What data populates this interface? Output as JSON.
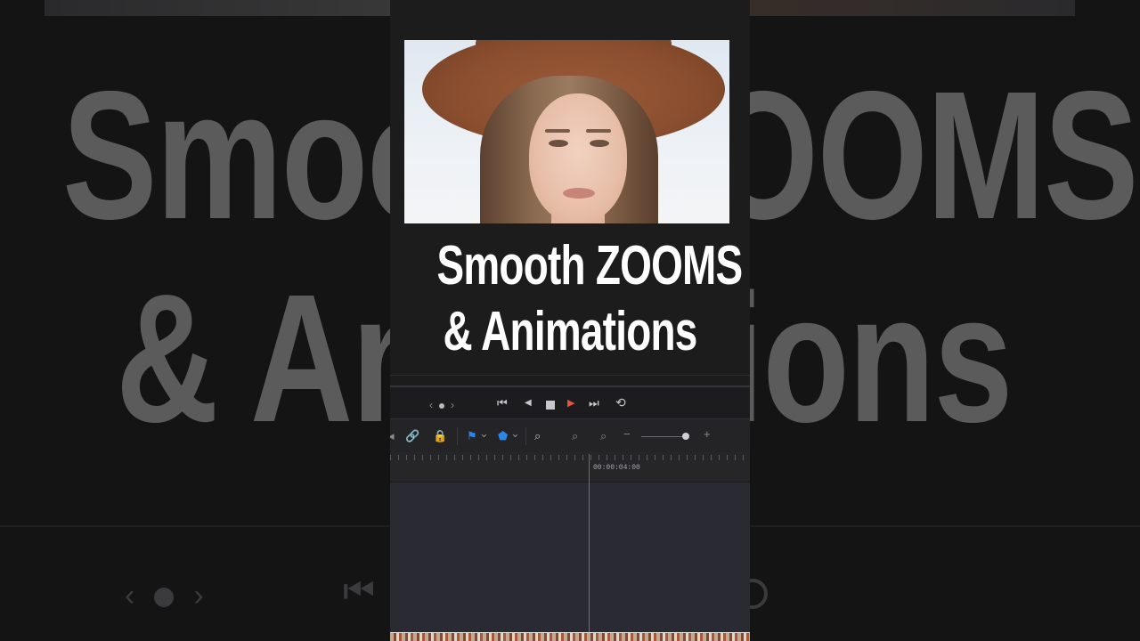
{
  "background": {
    "line1": "Smooth ZOOMS",
    "line2": "& Animations"
  },
  "title": {
    "line1": "Smooth ZOOMS",
    "line2": "& Animations"
  },
  "transport": {
    "prev_glyph": "‹",
    "next_glyph": "›",
    "skip_back_glyph": "⏮",
    "step_back_glyph": "◀",
    "play_glyph": "▶",
    "skip_forward_glyph": "⏭",
    "loop_glyph": "⟲"
  },
  "toolbar": {
    "link_glyph": "🔗",
    "lock_glyph": "🔒",
    "chevron_glyph": "⌄",
    "zoom_out_glyph": "−",
    "zoom_in_glyph": "+",
    "zoom_level": 0.9
  },
  "timeline": {
    "timecode": "00:00:04:00"
  },
  "colors": {
    "play": "#e8523a",
    "accent_blue": "#2a86e8"
  }
}
